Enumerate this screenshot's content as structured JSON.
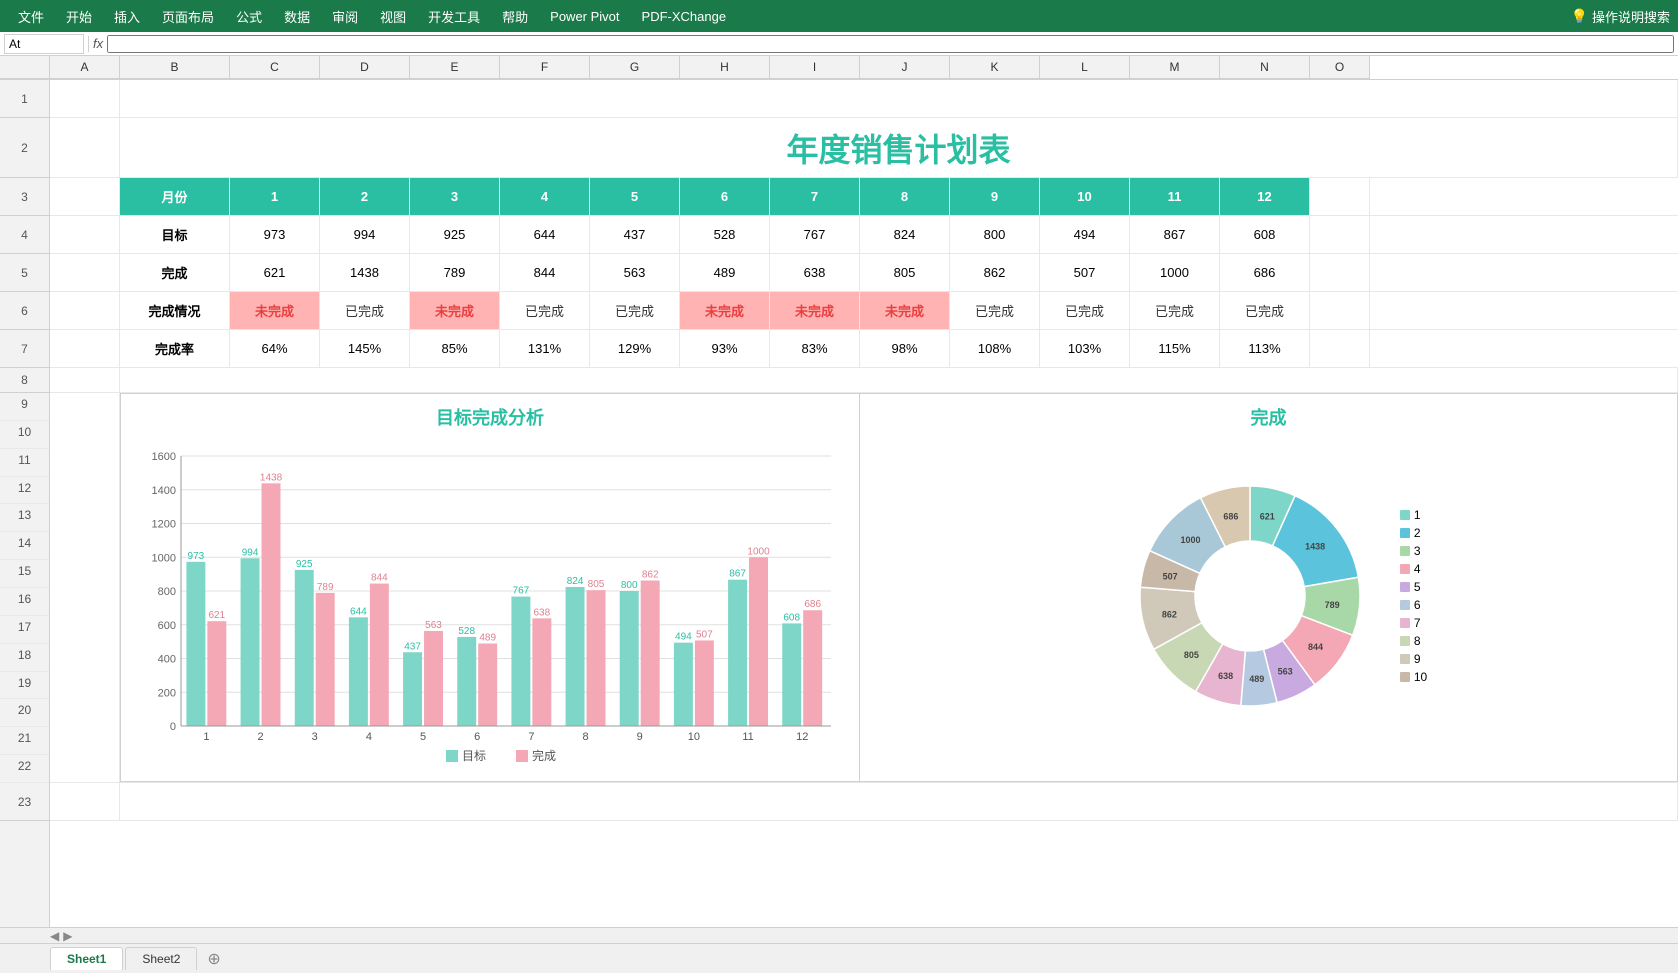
{
  "ribbon": {
    "items": [
      "文件",
      "开始",
      "插入",
      "页面布局",
      "公式",
      "数据",
      "审阅",
      "视图",
      "开发工具",
      "帮助",
      "Power Pivot",
      "PDF-XChange"
    ],
    "search": "操作说明搜索"
  },
  "formula_bar": {
    "name_box": "At",
    "formula": ""
  },
  "col_headers": [
    "A",
    "B",
    "C",
    "D",
    "E",
    "F",
    "G",
    "H",
    "I",
    "J",
    "K",
    "L",
    "M",
    "N",
    "O"
  ],
  "row_numbers": [
    "1",
    "2",
    "3",
    "4",
    "5",
    "6",
    "7",
    "8",
    "9",
    "10",
    "11",
    "12",
    "13",
    "14",
    "15",
    "16",
    "17",
    "18",
    "19",
    "20",
    "21",
    "22",
    "23"
  ],
  "title": "年度销售计划表",
  "table": {
    "headers": [
      "月份",
      "1",
      "2",
      "3",
      "4",
      "5",
      "6",
      "7",
      "8",
      "9",
      "10",
      "11",
      "12"
    ],
    "rows": [
      {
        "label": "目标",
        "values": [
          "973",
          "994",
          "925",
          "644",
          "437",
          "528",
          "767",
          "824",
          "800",
          "494",
          "867",
          "608"
        ]
      },
      {
        "label": "完成",
        "values": [
          "621",
          "1438",
          "789",
          "844",
          "563",
          "489",
          "638",
          "805",
          "862",
          "507",
          "1000",
          "686"
        ]
      },
      {
        "label": "完成情况",
        "values": [
          "未完成",
          "已完成",
          "未完成",
          "已完成",
          "已完成",
          "未完成",
          "未完成",
          "未完成",
          "已完成",
          "已完成",
          "已完成",
          "已完成"
        ]
      },
      {
        "label": "完成率",
        "values": [
          "64%",
          "145%",
          "85%",
          "131%",
          "129%",
          "93%",
          "83%",
          "98%",
          "108%",
          "103%",
          "115%",
          "113%"
        ]
      }
    ]
  },
  "bar_chart": {
    "title": "目标完成分析",
    "legend": [
      "目标",
      "完成"
    ],
    "categories": [
      "1",
      "2",
      "3",
      "4",
      "5",
      "6",
      "7",
      "8",
      "9",
      "10",
      "11",
      "12"
    ],
    "target": [
      973,
      994,
      925,
      644,
      437,
      528,
      767,
      824,
      800,
      494,
      867,
      608
    ],
    "actual": [
      621,
      1438,
      789,
      844,
      563,
      489,
      638,
      805,
      862,
      507,
      1000,
      686
    ]
  },
  "donut_chart": {
    "title": "完成",
    "legend": [
      "1",
      "2",
      "3",
      "4",
      "5",
      "6",
      "7",
      "8",
      "9",
      "10"
    ],
    "values": [
      621,
      1438,
      789,
      844,
      563,
      489,
      638,
      805,
      862,
      507,
      1000,
      686
    ],
    "labels": [
      "621",
      "1438",
      "789",
      "844",
      "563",
      "489",
      "638",
      "805",
      "862",
      "507",
      "1000",
      "686"
    ]
  },
  "tabs": [
    "Sheet1",
    "Sheet2"
  ],
  "active_tab": "Sheet1",
  "status_done": "已完成",
  "status_not_done": "未完成",
  "colors": {
    "teal": "#2abfa3",
    "ribbon_bg": "#1a7a4a",
    "not_done_bg": "#ffb3b3",
    "not_done_text": "#e84040",
    "bar_target": "#7dd6c8",
    "bar_actual": "#f4a7b5"
  }
}
